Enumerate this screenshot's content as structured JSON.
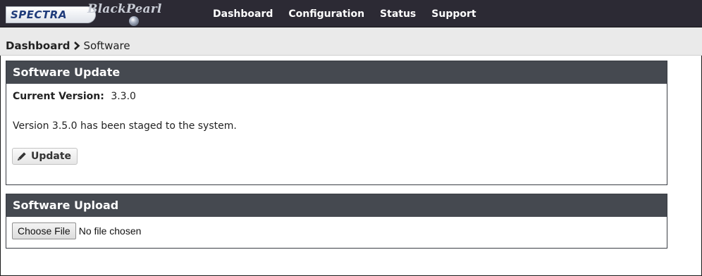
{
  "brand": {
    "logo_text": "SPECTRA",
    "product_text": "BlackPearl"
  },
  "nav": {
    "items": [
      {
        "label": "Dashboard"
      },
      {
        "label": "Configuration"
      },
      {
        "label": "Status"
      },
      {
        "label": "Support"
      }
    ]
  },
  "breadcrumb": {
    "home": "Dashboard",
    "separator_icon": "chevron-right-icon",
    "current": "Software"
  },
  "software_update": {
    "title": "Software Update",
    "current_version_label": "Current Version:",
    "current_version": "3.3.0",
    "staged_message": "Version 3.5.0 has been staged to the system.",
    "update_button_label": "Update",
    "update_button_icon": "pencil-icon"
  },
  "software_upload": {
    "title": "Software Upload",
    "choose_file_label": "Choose File",
    "file_status": "No file chosen"
  },
  "colors": {
    "topbar_bg": "#2c2a34",
    "panel_header_bg": "#454950",
    "breadcrumb_bg": "#eaeaea"
  }
}
